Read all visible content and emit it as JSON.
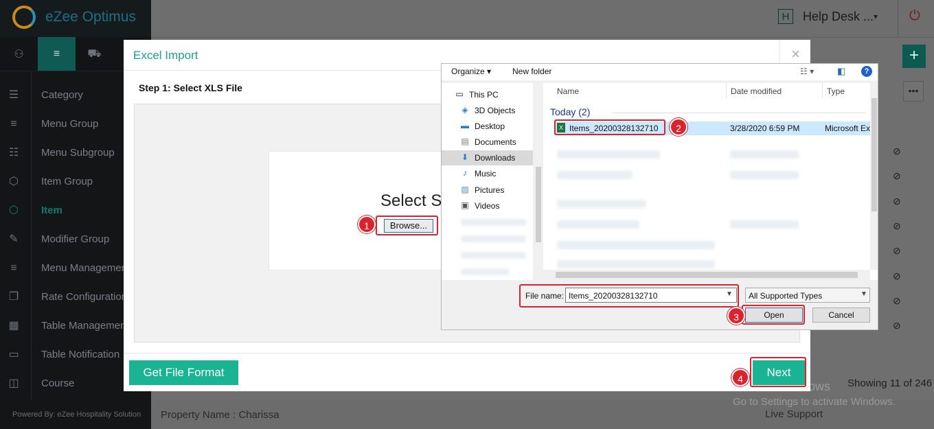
{
  "app": {
    "brand": "eZee Optimus",
    "powered_by": "Powered By: eZee Hospitality Solution"
  },
  "topbar": {
    "badge": "H",
    "helpdesk": "Help Desk ...",
    "caret": "▾",
    "power": "⏻"
  },
  "sidebar": {
    "tabs": [
      {
        "icon": "user-icon",
        "glyph": "⚇"
      },
      {
        "icon": "menu-icon",
        "glyph": "≡"
      },
      {
        "icon": "cart-icon",
        "glyph": "⛟"
      }
    ],
    "items": [
      {
        "label": "Category",
        "icon": "category-icon",
        "glyph": "☰"
      },
      {
        "label": "Menu Group",
        "icon": "list-icon",
        "glyph": "≡"
      },
      {
        "label": "Menu Subgroup",
        "icon": "sublist-icon",
        "glyph": "☷"
      },
      {
        "label": "Item Group",
        "icon": "box-icon",
        "glyph": "⬡"
      },
      {
        "label": "Item",
        "icon": "item-box-icon",
        "glyph": "⬡",
        "active": true
      },
      {
        "label": "Modifier Group",
        "icon": "edit-icon",
        "glyph": "✎"
      },
      {
        "label": "Menu Management",
        "icon": "menu-manage-icon",
        "glyph": "≡"
      },
      {
        "label": "Rate Configuration",
        "icon": "copy-icon",
        "glyph": "❐"
      },
      {
        "label": "Table Management",
        "icon": "grid-icon",
        "glyph": "▦"
      },
      {
        "label": "Table Notification",
        "icon": "chat-icon",
        "glyph": "▭"
      },
      {
        "label": "Course",
        "icon": "book-icon",
        "glyph": "◫"
      }
    ]
  },
  "page": {
    "plus": "+",
    "dots": "•••",
    "showing": "Showing 11 of 246",
    "property": "Property Name : Charissa",
    "live_support": "Live Support",
    "activate_title": "Activate Windows",
    "activate_sub": "Go to Settings to activate Windows."
  },
  "modal": {
    "title": "Excel Import",
    "close": "×",
    "step": "Step 1: Select XLS File",
    "select_text": "Select S",
    "browse": "Browse...",
    "get_file_format": "Get File Format",
    "next": "Next"
  },
  "file_dialog": {
    "organize": "Organize ▾",
    "new_folder": "New folder",
    "view": "☷ ▾",
    "help": "?",
    "nav": [
      {
        "label": "This PC",
        "icon": "pc-icon",
        "glyph": "🖥"
      },
      {
        "label": "3D Objects",
        "icon": "cube-icon",
        "glyph": "◈"
      },
      {
        "label": "Desktop",
        "icon": "desktop-icon",
        "glyph": "▬"
      },
      {
        "label": "Documents",
        "icon": "documents-icon",
        "glyph": "▤"
      },
      {
        "label": "Downloads",
        "icon": "downloads-icon",
        "glyph": "⬇",
        "selected": true
      },
      {
        "label": "Music",
        "icon": "music-icon",
        "glyph": "♪"
      },
      {
        "label": "Pictures",
        "icon": "pictures-icon",
        "glyph": "▨"
      },
      {
        "label": "Videos",
        "icon": "videos-icon",
        "glyph": "▣"
      }
    ],
    "columns": {
      "name": "Name",
      "date": "Date modified",
      "type": "Type"
    },
    "group": "Today (2)",
    "file": {
      "name": "Items_20200328132710",
      "date": "3/28/2020 6:59 PM",
      "type": "Microsoft Ex"
    },
    "file_name_label": "File name:",
    "file_name_value": "Items_20200328132710",
    "filter": "All Supported Types",
    "open": "Open",
    "cancel": "Cancel"
  },
  "steps": [
    "1",
    "2",
    "3",
    "4"
  ],
  "colors": {
    "accent": "#1ab394",
    "highlight": "#d9232e",
    "sidebar_bg": "#131517"
  }
}
